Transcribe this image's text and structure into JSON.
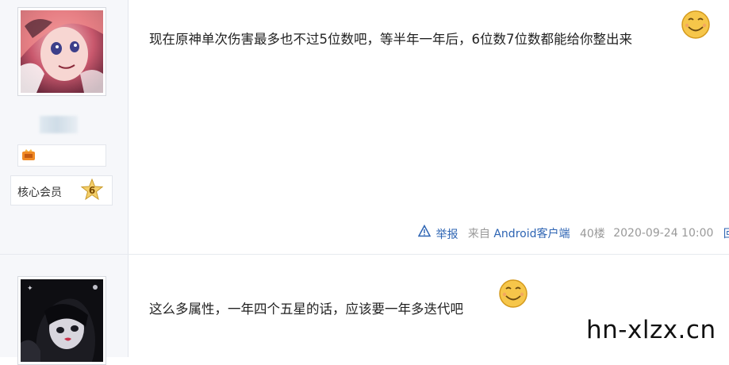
{
  "posts": [
    {
      "user": {
        "member_label": "核心会员",
        "level": "6"
      },
      "content": "现在原神单次伤害最多也不过5位数吧，等半年一年后，6位数7位数都能给你整出来",
      "emoji": "smiley-face-icon",
      "footer": {
        "report": "举报",
        "from": "来自",
        "client": "Android客户端",
        "floor": "40楼",
        "time": "2020-09-24 10:00",
        "reply": "回复"
      }
    },
    {
      "content": "这么多属性，一年四个五星的话，应该要一年多迭代吧",
      "emoji": "smiley-face-icon"
    }
  ],
  "watermark": "hn-xlzx.cn",
  "colors": {
    "link": "#2d64b3",
    "muted": "#999999",
    "sidebar_bg": "#f6f7fa"
  }
}
